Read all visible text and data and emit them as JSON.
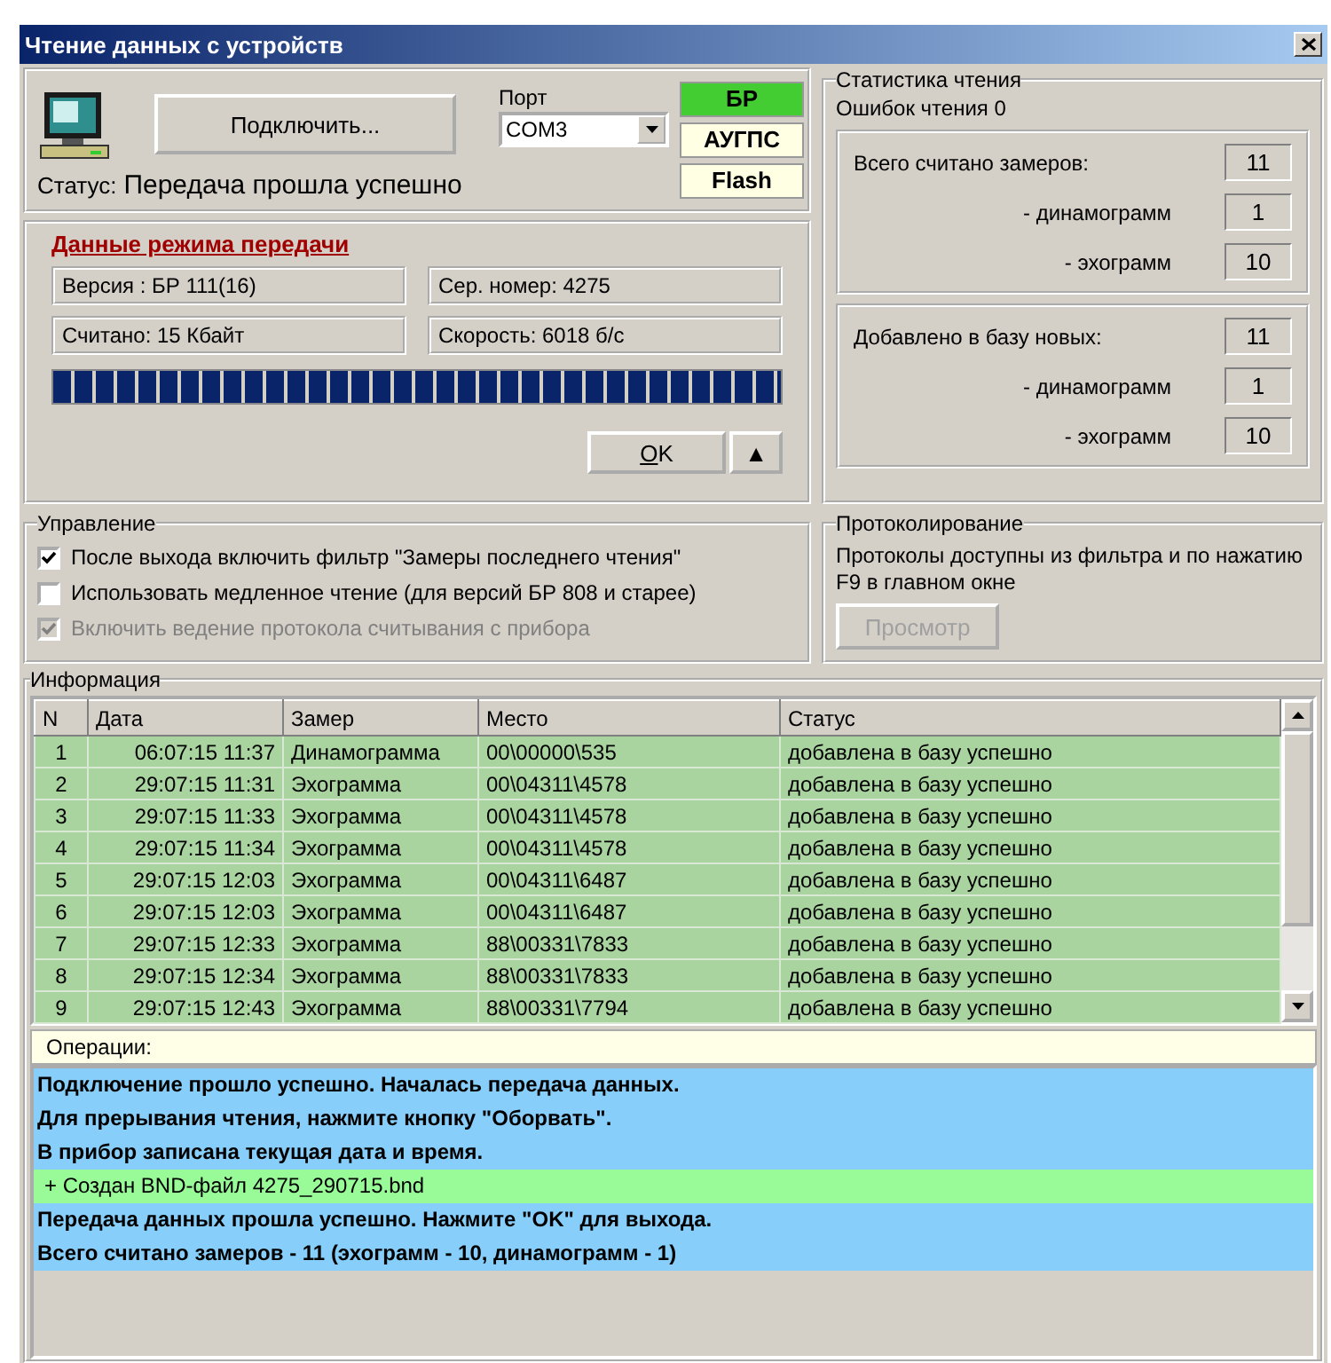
{
  "window": {
    "title": "Чтение данных с устройств"
  },
  "connection": {
    "connect_button": "Подключить...",
    "port_label": "Порт",
    "port_value": "COM3",
    "status_label": "Статус:",
    "status_value": "Передача прошла успешно",
    "devices": [
      {
        "label": "БР",
        "color": "#44cc33"
      },
      {
        "label": "АУГПС",
        "color": "#ffffe4"
      },
      {
        "label": "Flash",
        "color": "#ffffe4"
      }
    ]
  },
  "transfer": {
    "title": "Данные режима передачи",
    "fields": [
      "Версия : БР 111(16)",
      "Сер. номер: 4275",
      "Считано: 15 Кбайт",
      "Скорость: 6018 б/с"
    ],
    "progress": {
      "level": 1
    },
    "ok_button": "OK",
    "collapse_button": "▲"
  },
  "stats": {
    "title": "Статистика чтения",
    "errors": "Ошибок чтения 0",
    "groups": [
      {
        "rows": [
          {
            "kind": "total",
            "label": "Всего считано замеров:",
            "value": "11"
          },
          {
            "kind": "sub",
            "label": "- динамограмм",
            "value": "1"
          },
          {
            "kind": "sub",
            "label": "- эхограмм",
            "value": "10"
          }
        ]
      },
      {
        "rows": [
          {
            "kind": "total",
            "label": "Добавлено в базу новых:",
            "value": "11"
          },
          {
            "kind": "sub",
            "label": "- динамограмм",
            "value": "1"
          },
          {
            "kind": "sub",
            "label": "- эхограмм",
            "value": "10"
          }
        ]
      }
    ]
  },
  "control": {
    "title": "Управление",
    "options": [
      {
        "label": "После выхода включить фильтр \"Замеры последнего чтения\"",
        "checked": true,
        "disabled": false
      },
      {
        "label": "Использовать медленное чтение  (для версий БР 808 и старее)",
        "checked": false,
        "disabled": false
      },
      {
        "label": "Включить ведение протокола считывания с прибора",
        "checked": true,
        "disabled": true
      }
    ]
  },
  "logging": {
    "title": "Протоколирование",
    "text": "Протоколы доступны из фильтра и по нажатию F9  в главном окне",
    "button": {
      "label": "Просмотр",
      "disabled": true
    }
  },
  "info": {
    "title": "Информация",
    "table": {
      "columns": [
        "N",
        "Дата",
        "Замер",
        "Место",
        "Статус"
      ],
      "rows": [
        [
          "1",
          "06:07:15 11:37",
          "Динамограмма",
          "00\\00000\\535",
          "добавлена в базу успешно"
        ],
        [
          "2",
          "29:07:15 11:31",
          "Эхограмма",
          "00\\04311\\4578",
          "добавлена в базу успешно"
        ],
        [
          "3",
          "29:07:15 11:33",
          "Эхограмма",
          "00\\04311\\4578",
          "добавлена в базу успешно"
        ],
        [
          "4",
          "29:07:15 11:34",
          "Эхограмма",
          "00\\04311\\4578",
          "добавлена в базу успешно"
        ],
        [
          "5",
          "29:07:15 12:03",
          "Эхограмма",
          "00\\04311\\6487",
          "добавлена в базу успешно"
        ],
        [
          "6",
          "29:07:15 12:03",
          "Эхограмма",
          "00\\04311\\6487",
          "добавлена в базу успешно"
        ],
        [
          "7",
          "29:07:15 12:33",
          "Эхограмма",
          "88\\00331\\7833",
          "добавлена в базу успешно"
        ],
        [
          "8",
          "29:07:15 12:34",
          "Эхограмма",
          "88\\00331\\7833",
          "добавлена в базу успешно"
        ],
        [
          "9",
          "29:07:15 12:43",
          "Эхограмма",
          "88\\00331\\7794",
          "добавлена в базу успешно"
        ]
      ]
    },
    "operations": {
      "title": "Операции:",
      "lines": [
        {
          "kind": "message",
          "text": "Подключение прошло успешно. Началась передача данных."
        },
        {
          "kind": "message",
          "text": "Для прерывания чтения, нажмите кнопку \"Оборвать\"."
        },
        {
          "kind": "message",
          "text": "В прибор записана текущая дата и время."
        },
        {
          "kind": "file",
          "text": "+ Создан BND-файл 4275_290715.bnd"
        },
        {
          "kind": "message",
          "text": "Передача данных прошла успешно. Нажмите \"OK\" для выхода."
        },
        {
          "kind": "message",
          "text": "Всего считано замеров - 11 (эхограмм - 10, динамограмм - 1)"
        }
      ]
    }
  }
}
